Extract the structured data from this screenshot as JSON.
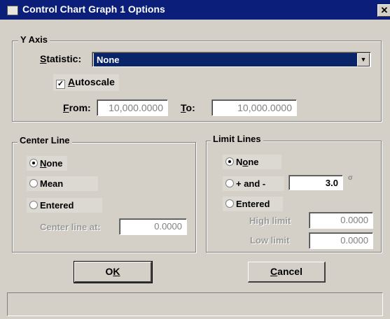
{
  "window": {
    "title": "Control Chart Graph 1 Options",
    "close_glyph": "✕"
  },
  "y_axis": {
    "group_label": "Y Axis",
    "statistic_label_pre": "",
    "statistic_label_u": "S",
    "statistic_label_post": "tatistic:",
    "statistic_value": "None",
    "autoscale_pre": "",
    "autoscale_u": "A",
    "autoscale_post": "utoscale",
    "autoscale_checked": true,
    "from_label_u": "F",
    "from_label_post": "rom:",
    "from_value": "10,000.0000",
    "to_label_u": "T",
    "to_label_post": "o:",
    "to_value": "10,000.0000"
  },
  "center_line": {
    "group_label": "Center Line",
    "options": [
      {
        "pre": "",
        "u": "N",
        "post": "one",
        "selected": true
      },
      {
        "pre": "",
        "u": "",
        "post": "Mean",
        "selected": false
      },
      {
        "pre": "",
        "u": "",
        "post": "Entered",
        "selected": false
      }
    ],
    "center_line_at_label": "Center line at:",
    "center_line_at_value": "0.0000"
  },
  "limit_lines": {
    "group_label": "Limit Lines",
    "options": [
      {
        "pre": "N",
        "u": "o",
        "post": "ne",
        "selected": true
      },
      {
        "pre": "",
        "u": "",
        "post": "+ and -",
        "selected": false
      },
      {
        "pre": "",
        "u": "",
        "post": "Entered",
        "selected": false
      }
    ],
    "sigma_value": "3.0",
    "sigma_symbol": "σ",
    "high_limit_label": "High limit",
    "high_limit_value": "0.0000",
    "low_limit_label": "Low limit",
    "low_limit_value": "0.0000"
  },
  "buttons": {
    "ok_pre": "O",
    "ok_u": "K",
    "cancel_u": "C",
    "cancel_post": "ancel"
  },
  "status_bar": {
    "text": ""
  },
  "colors": {
    "title_bar": "#0a1e7a",
    "dialog_bg": "#d4d0c8",
    "selection": "#0a246a"
  },
  "icons": [
    "app-icon",
    "close-icon",
    "dropdown-arrow-icon",
    "checkbox-icon",
    "radio-icon"
  ]
}
